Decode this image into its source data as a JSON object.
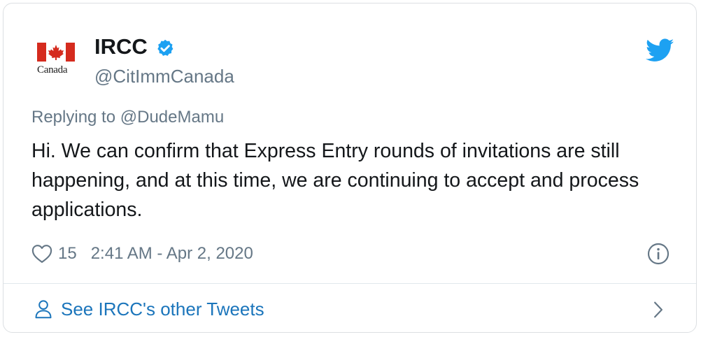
{
  "author": {
    "display_name": "IRCC",
    "handle": "@CitImmCanada",
    "logo_wordmark": "Canada",
    "verified": true
  },
  "tweet": {
    "replying_prefix": "Replying to",
    "replying_to": "@DudeMamu",
    "text": "Hi. We can confirm that Express Entry rounds of invitations are still happening, and at this time, we are continuing to accept and process applications.",
    "like_count": "15",
    "timestamp": "2:41 AM - Apr 2, 2020"
  },
  "footer": {
    "see_more_label": "See IRCC's other Tweets"
  },
  "icons": {
    "verified": "verified-badge-icon",
    "twitter": "twitter-bird-icon",
    "like": "heart-icon",
    "info": "info-icon",
    "profile": "person-icon",
    "chevron": "chevron-right-icon"
  },
  "colors": {
    "twitter_blue": "#1da1f2",
    "link_blue": "#1b75bb",
    "text": "#14171a",
    "muted": "#657786",
    "canada_red": "#d52b1e"
  }
}
